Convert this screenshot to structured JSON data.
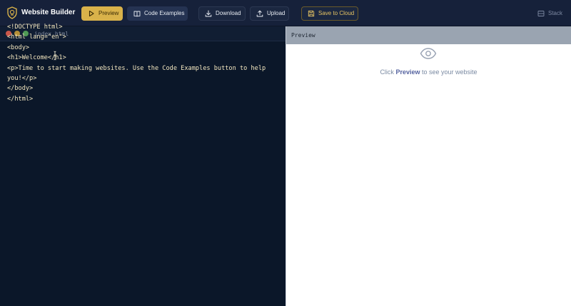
{
  "toolbar": {
    "brand": "Website Builder",
    "preview_label": "Preview",
    "examples_label": "Code Examples",
    "download_label": "Download",
    "upload_label": "Upload",
    "save_label": "Save to Cloud",
    "stack_label": "Stack"
  },
  "editor": {
    "filename": "index.html",
    "code": "<!DOCTYPE html>\n<html lang=\"en\">\n<body>\n<h1>Welcome</h1>\n<p>Time to start making websites. Use the Code Examples button to help you!</p>\n</body>\n</html>"
  },
  "preview": {
    "title": "Preview",
    "hint_prefix": "Click",
    "hint_bold": "Preview",
    "hint_suffix": "to see your website"
  },
  "colors": {
    "toolbar_bg": "#16213a",
    "editor_bg": "#0b1729",
    "accent": "#d9b24a",
    "code_text": "#f2e6bf"
  },
  "icons": {
    "logo": "shield-logo-icon",
    "preview": "play-icon",
    "examples": "book-icon",
    "download": "download-icon",
    "upload": "upload-icon",
    "save": "save-icon",
    "stack": "stack-layout-icon",
    "eye": "eye-icon"
  }
}
